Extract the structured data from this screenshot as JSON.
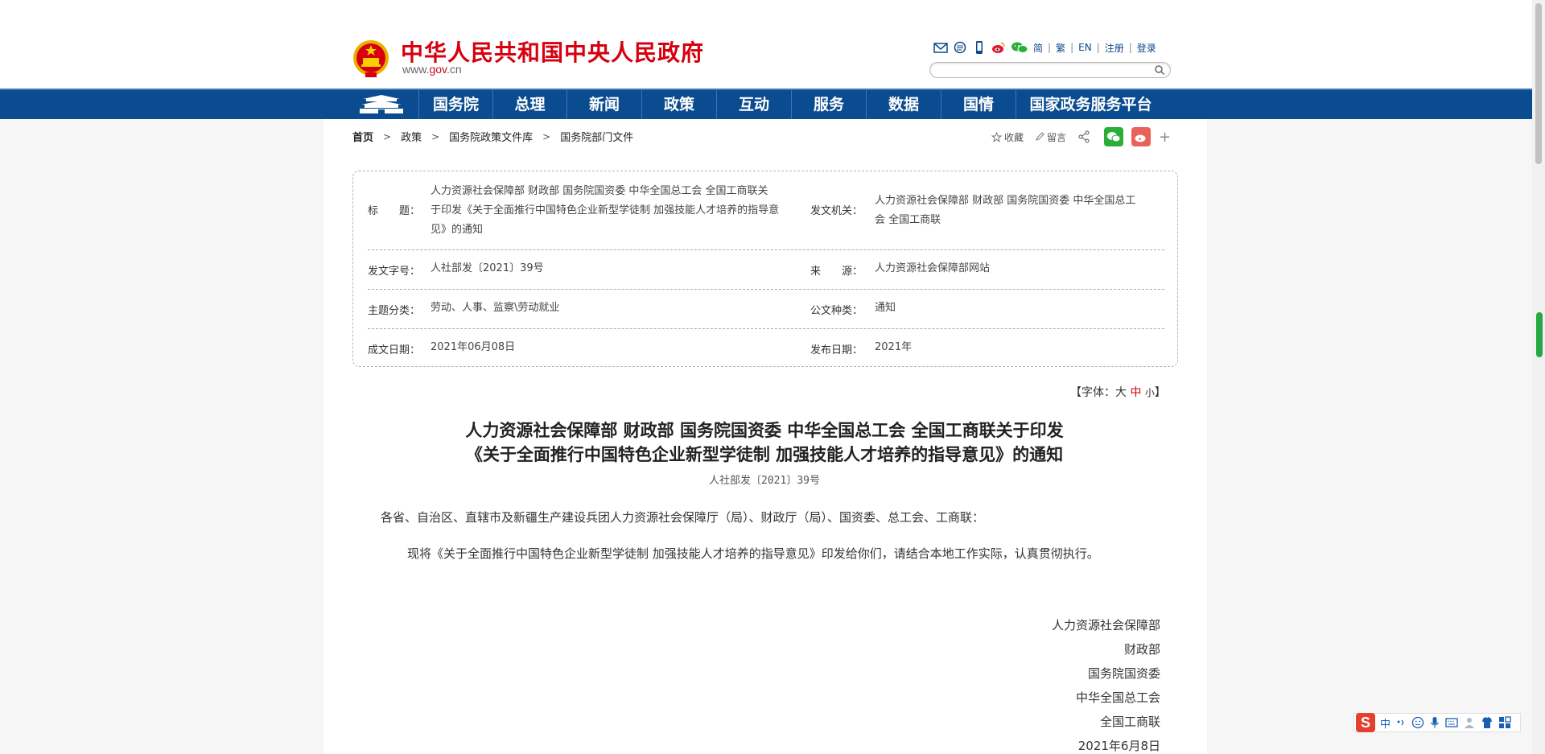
{
  "header": {
    "site_title": "中华人民共和国中央人民政府",
    "site_url_pre": "www.",
    "site_url_gov": "gov",
    "site_url_post": ".cn",
    "lang_links": [
      "简",
      "繁",
      "EN",
      "注册",
      "登录"
    ],
    "icons": [
      "mail-icon",
      "rss-icon",
      "mobile-icon",
      "weibo-icon",
      "wechat-icon"
    ],
    "search_placeholder": ""
  },
  "nav": {
    "items": [
      "国务院",
      "总理",
      "新闻",
      "政策",
      "互动",
      "服务",
      "数据",
      "国情",
      "国家政务服务平台"
    ]
  },
  "breadcrumb": [
    "首页",
    "政策",
    "国务院政策文件库",
    "国务院部门文件"
  ],
  "tools": {
    "favorite": "收藏",
    "comment": "留言",
    "plus": "+"
  },
  "info": {
    "title_label": "标　　题：",
    "title_line1": "人力资源社会保障部 财政部 国务院国资委 中华全国总工会 全国工商联关",
    "title_line2": "于印发《关于全面推行中国特色企业新型学徒制 加强技能人才培养的指导意",
    "title_line3": "见》的通知",
    "issuer_label": "发文机关：",
    "issuer_line1": "人力资源社会保障部 财政部 国务院国资委 中华全国总工",
    "issuer_line2": "会 全国工商联",
    "docno_label": "发文字号：",
    "docno": "人社部发〔2021〕39号",
    "source_label": "来　　源：",
    "source": "人力资源社会保障部网站",
    "topic_label": "主题分类：",
    "topic": "劳动、人事、监察\\劳动就业",
    "type_label": "公文种类：",
    "type": "通知",
    "date_label": "成文日期：",
    "date": "2021年06月08日",
    "pub_label": "发布日期：",
    "pub": "2021年"
  },
  "font_ctl": {
    "prefix": "【字体：",
    "large": "大",
    "medium": "中",
    "small": "小",
    "suffix": "】"
  },
  "doc": {
    "title_line1": "人力资源社会保障部 财政部 国务院国资委 中华全国总工会 全国工商联关于印发",
    "title_line2": "《关于全面推行中国特色企业新型学徒制 加强技能人才培养的指导意见》的通知",
    "doc_no": "人社部发〔2021〕39号",
    "salutation": "各省、自治区、直辖市及新疆生产建设兵团人力资源社会保障厅（局）、财政厅（局）、国资委、总工会、工商联：",
    "body": "现将《关于全面推行中国特色企业新型学徒制 加强技能人才培养的指导意见》印发给你们，请结合本地工作实际，认真贯彻执行。",
    "signatures": [
      "人力资源社会保障部",
      "财政部",
      "国务院国资委",
      "中华全国总工会",
      "全国工商联",
      "2021年6月8日"
    ]
  },
  "ime": {
    "logo": "S",
    "mode": "中"
  },
  "colors": {
    "brand_red": "#d6000f",
    "nav_blue": "#0b4b8f"
  }
}
